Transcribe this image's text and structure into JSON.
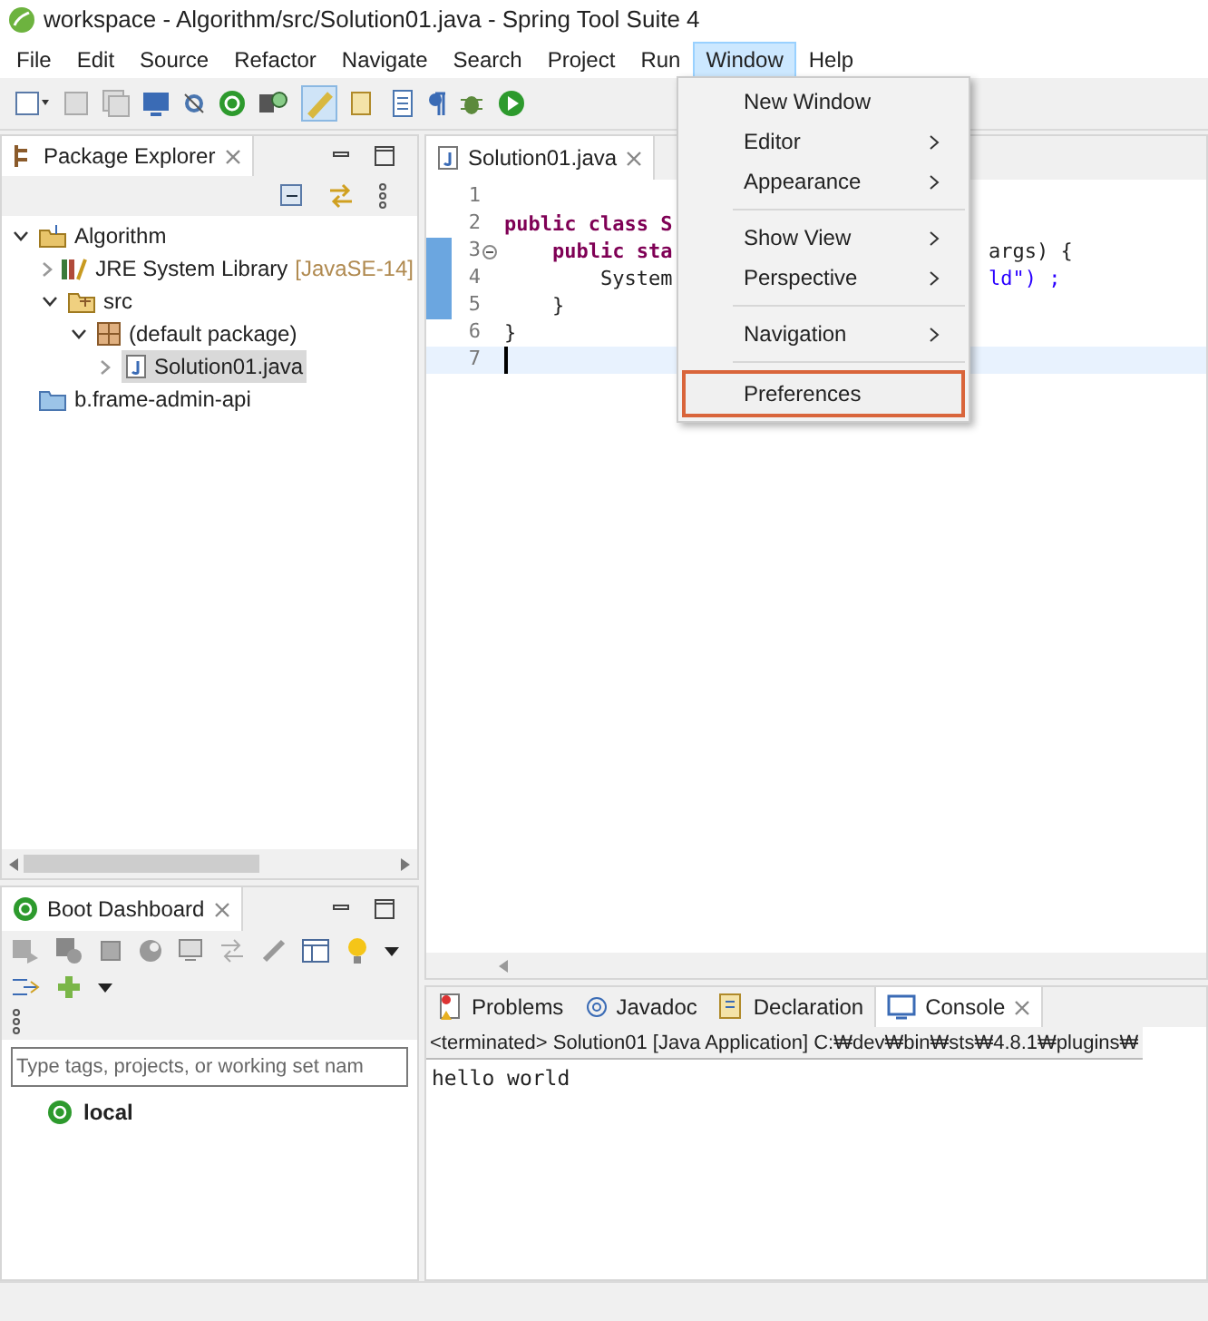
{
  "window": {
    "title": "workspace - Algorithm/src/Solution01.java - Spring Tool Suite 4"
  },
  "menu_bar": [
    {
      "label": "File",
      "selected": false
    },
    {
      "label": "Edit",
      "selected": false
    },
    {
      "label": "Source",
      "selected": false
    },
    {
      "label": "Refactor",
      "selected": false
    },
    {
      "label": "Navigate",
      "selected": false
    },
    {
      "label": "Search",
      "selected": false
    },
    {
      "label": "Project",
      "selected": false
    },
    {
      "label": "Run",
      "selected": false
    },
    {
      "label": "Window",
      "selected": true
    },
    {
      "label": "Help",
      "selected": false
    }
  ],
  "window_menu": [
    {
      "kind": "item",
      "label": "New Window",
      "submenu": false,
      "highlighted": false
    },
    {
      "kind": "item",
      "label": "Editor",
      "submenu": true,
      "highlighted": false
    },
    {
      "kind": "item",
      "label": "Appearance",
      "submenu": true,
      "highlighted": false
    },
    {
      "kind": "separator"
    },
    {
      "kind": "item",
      "label": "Show View",
      "submenu": true,
      "highlighted": false
    },
    {
      "kind": "item",
      "label": "Perspective",
      "submenu": true,
      "highlighted": false
    },
    {
      "kind": "separator"
    },
    {
      "kind": "item",
      "label": "Navigation",
      "submenu": true,
      "highlighted": false
    },
    {
      "kind": "separator"
    },
    {
      "kind": "item",
      "label": "Preferences",
      "submenu": false,
      "highlighted": true
    }
  ],
  "package_explorer": {
    "title": "Package Explorer",
    "tree": [
      {
        "label": "Algorithm",
        "kind": "project",
        "expanded": true,
        "selected": false,
        "children": [
          {
            "label": "JRE System Library",
            "decoration": "[JavaSE-14]",
            "kind": "library",
            "expanded": false,
            "selected": false
          },
          {
            "label": "src",
            "kind": "sourcefolder",
            "expanded": true,
            "selected": false,
            "children": [
              {
                "label": "(default package)",
                "kind": "package",
                "expanded": true,
                "selected": false,
                "children": [
                  {
                    "label": "Solution01.java",
                    "kind": "javafile",
                    "expanded": false,
                    "selected": true
                  }
                ]
              }
            ]
          }
        ]
      },
      {
        "label": "b.frame-admin-api",
        "kind": "folder",
        "selected": false
      }
    ]
  },
  "editor": {
    "tab": "Solution01.java",
    "lines": [
      {
        "number": "1"
      },
      {
        "number": "2",
        "left": "public class S"
      },
      {
        "number": "3",
        "left": "    public sta",
        "right": "args) {",
        "fold": true
      },
      {
        "number": "4",
        "left": "        System",
        "right": "ld\") ;"
      },
      {
        "number": "5",
        "left": "    }"
      },
      {
        "number": "6",
        "left": "}"
      },
      {
        "number": "7",
        "current": true
      }
    ]
  },
  "boot_dashboard": {
    "title": "Boot Dashboard",
    "filter": {
      "placeholder": "Type tags, projects, or working set nam"
    },
    "items": [
      {
        "label": "local"
      }
    ]
  },
  "bottom_panel": {
    "tabs": [
      {
        "label": "Problems",
        "selected": false
      },
      {
        "label": "Javadoc",
        "selected": false
      },
      {
        "label": "Declaration",
        "selected": false
      },
      {
        "label": "Console",
        "selected": true
      }
    ],
    "console_header": "<terminated> Solution01 [Java Application] C:₩dev₩bin₩sts₩4.8.1₩plugins₩",
    "output": "hello world"
  }
}
